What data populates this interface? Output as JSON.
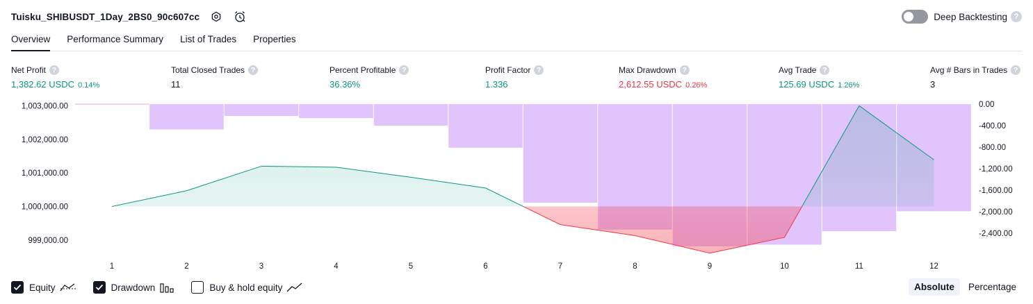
{
  "header": {
    "strategy_name": "Tuisku_SHIBUSDT_1Day_2BS0_90c607cc"
  },
  "deep_backtesting": {
    "label": "Deep Backtesting",
    "enabled": false,
    "help": "?"
  },
  "tabs": [
    {
      "label": "Overview",
      "active": true
    },
    {
      "label": "Performance Summary",
      "active": false
    },
    {
      "label": "List of Trades",
      "active": false
    },
    {
      "label": "Properties",
      "active": false
    }
  ],
  "stats": [
    {
      "label": "Net Profit",
      "value": "1,382.62 USDC",
      "pct": "0.14%",
      "color": "green"
    },
    {
      "label": "Total Closed Trades",
      "value": "11",
      "pct": "",
      "color": "neutral"
    },
    {
      "label": "Percent Profitable",
      "value": "36.36%",
      "pct": "",
      "color": "green"
    },
    {
      "label": "Profit Factor",
      "value": "1.336",
      "pct": "",
      "color": "green"
    },
    {
      "label": "Max Drawdown",
      "value": "2,612.55 USDC",
      "pct": "0.26%",
      "color": "red"
    },
    {
      "label": "Avg Trade",
      "value": "125.69 USDC",
      "pct": "1.26%",
      "color": "green"
    },
    {
      "label": "Avg # Bars in Trades",
      "value": "3",
      "pct": "",
      "color": "neutral"
    }
  ],
  "chart_data": {
    "type": "line",
    "x": [
      1,
      2,
      3,
      4,
      5,
      6,
      7,
      8,
      9,
      10,
      11,
      12
    ],
    "x_tick_labels": [
      "1",
      "2",
      "3",
      "4",
      "5",
      "6",
      "7",
      "8",
      "9",
      "10",
      "11",
      "12"
    ],
    "y_left_ticks": [
      "1,003,000.00",
      "1,002,000.00",
      "1,001,000.00",
      "1,000,000.00",
      "999,000.00"
    ],
    "y_left_range": [
      998500,
      1003050
    ],
    "y_right_ticks": [
      "0.00",
      "-400.00",
      "-800.00",
      "-1,200.00",
      "-1,600.00",
      "-2,000.00",
      "-2,400.00"
    ],
    "y_right_range": [
      -2700,
      0
    ],
    "baseline": 1000000,
    "series": [
      {
        "name": "Equity",
        "kind": "line",
        "color_up": "#089981",
        "color_down": "#f23645",
        "values": [
          1000000,
          1000470,
          1001200,
          1001170,
          1000870,
          1000550,
          999460,
          999130,
          998610,
          999080,
          1003000,
          1001390
        ]
      },
      {
        "name": "Drawdown",
        "kind": "bar",
        "axis": "right",
        "color": "#e1c4fb",
        "values": [
          0,
          -470,
          -220,
          -260,
          -400,
          -810,
          -1830,
          -2330,
          -2640,
          -2610,
          -2360,
          -1990
        ]
      }
    ],
    "legend": "bottom-left",
    "grid": false
  },
  "legend": [
    {
      "label": "Equity",
      "checked": true,
      "icon": "equity-icon"
    },
    {
      "label": "Drawdown",
      "checked": true,
      "icon": "drawdown-bars-icon"
    },
    {
      "label": "Buy & hold equity",
      "checked": false,
      "icon": "buy-hold-icon"
    }
  ],
  "mode": [
    {
      "label": "Absolute",
      "active": true
    },
    {
      "label": "Percentage",
      "active": false
    }
  ],
  "colors": {
    "green": "#089981",
    "red": "#f23645",
    "drawdown": "#e1c4fb",
    "text": "#131722"
  }
}
